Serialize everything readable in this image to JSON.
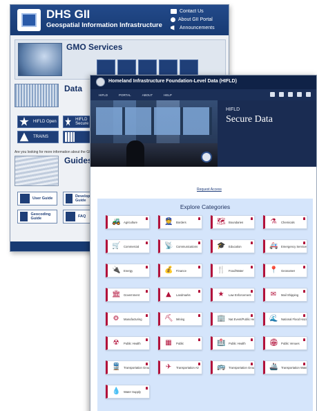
{
  "gii": {
    "title": "DHS GII",
    "subtitle": "Geospatial Information Infrastructure",
    "links": [
      "Contact Us",
      "About GII Portal",
      "Announcements"
    ],
    "gmo": {
      "title": "GMO Services",
      "description": "",
      "buttons": [
        "",
        "",
        "",
        "",
        ""
      ]
    },
    "data": {
      "title": "Data",
      "buttons": [
        "HIFLD Open",
        "HIFLD Secure",
        "TRAINS",
        ""
      ]
    },
    "more_info": "Are you looking for more information about the GII...",
    "guides": {
      "title": "Guides",
      "buttons": [
        "User Guide",
        "Developer Guide",
        "Geocoding Guide",
        "FAQ"
      ]
    },
    "footer_note": ""
  },
  "hifld": {
    "site_title": "Homeland Infrastructure Foundation-Level Data (HIFLD)",
    "nav": [
      "HIFLD",
      "PORTAL",
      "ABOUT",
      "HELP"
    ],
    "hero": {
      "kicker": "HIFLD",
      "title": "Secure Data",
      "description": ""
    },
    "note": "",
    "request_access": "Request Access",
    "categories_title": "Explore Categories",
    "categories": [
      {
        "label": "Agriculture",
        "icon": "tractor-icon",
        "glyph": "🚜"
      },
      {
        "label": "Borders",
        "icon": "border-officer-icon",
        "glyph": "👮"
      },
      {
        "label": "Boundaries",
        "icon": "map-icon",
        "glyph": "🗺"
      },
      {
        "label": "Chemicals",
        "icon": "flask-icon",
        "glyph": "⚗"
      },
      {
        "label": "Commercial",
        "icon": "cart-icon",
        "glyph": "🛒"
      },
      {
        "label": "Communications",
        "icon": "tower-icon",
        "glyph": "📡"
      },
      {
        "label": "Education",
        "icon": "graduation-cap-icon",
        "glyph": "🎓"
      },
      {
        "label": "Emergency Services",
        "icon": "ambulance-icon",
        "glyph": "🚑"
      },
      {
        "label": "Energy",
        "icon": "plug-icon",
        "glyph": "🔌"
      },
      {
        "label": "Finance",
        "icon": "money-bag-icon",
        "glyph": "💰"
      },
      {
        "label": "Food/Water",
        "icon": "utensils-icon",
        "glyph": "🍴"
      },
      {
        "label": "Geonames",
        "icon": "map-pin-icon",
        "glyph": "📍"
      },
      {
        "label": "Government",
        "icon": "capitol-icon",
        "glyph": "🏛"
      },
      {
        "label": "Landmarks",
        "icon": "monument-icon",
        "glyph": "▲"
      },
      {
        "label": "Law Enforcement",
        "icon": "badge-icon",
        "glyph": "★"
      },
      {
        "label": "Mail Shipping",
        "icon": "envelope-icon",
        "glyph": "✉"
      },
      {
        "label": "Manufacturing",
        "icon": "gear-icon",
        "glyph": "⚙"
      },
      {
        "label": "Mining",
        "icon": "pickaxe-icon",
        "glyph": "⛏"
      },
      {
        "label": "Nat Event/Public Health",
        "icon": "building-icon",
        "glyph": "🏢"
      },
      {
        "label": "National Flood Hazard",
        "icon": "wave-icon",
        "glyph": "🌊"
      },
      {
        "label": "Public Health",
        "icon": "radiation-icon",
        "glyph": "☢"
      },
      {
        "label": "Public",
        "icon": "grid-icon",
        "glyph": "▦"
      },
      {
        "label": "Public Health",
        "icon": "hospital-icon",
        "glyph": "🏥"
      },
      {
        "label": "Public Venues",
        "icon": "venue-icon",
        "glyph": "🏟"
      },
      {
        "label": "Transportation Ground",
        "icon": "railroad-icon",
        "glyph": "🚆"
      },
      {
        "label": "Transportation Air",
        "icon": "airplane-icon",
        "glyph": "✈"
      },
      {
        "label": "Transportation Ground",
        "icon": "bus-icon",
        "glyph": "🚌"
      },
      {
        "label": "Transportation Water",
        "icon": "ship-icon",
        "glyph": "🚢"
      },
      {
        "label": "Water Supply",
        "icon": "water-drop-icon",
        "glyph": "💧"
      }
    ],
    "accent_color": "#b2123b",
    "category_bg": "#d5e5fb"
  }
}
